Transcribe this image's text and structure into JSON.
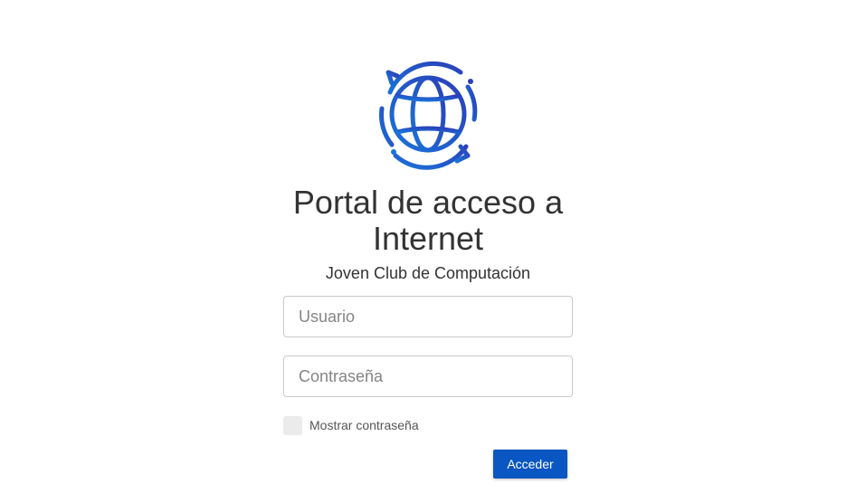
{
  "logo": {
    "icon": "globe-refresh-icon",
    "color_start": "#1a73d9",
    "color_end": "#2b3fb8"
  },
  "header": {
    "title_line1": "Portal de acceso a",
    "title_line2": "Internet",
    "subtitle": "Joven Club de Computación"
  },
  "form": {
    "username": {
      "placeholder": "Usuario",
      "value": ""
    },
    "password": {
      "placeholder": "Contraseña",
      "value": ""
    },
    "show_password_label": "Mostrar contraseña",
    "show_password_checked": false,
    "submit_label": "Acceder",
    "submit_color": "#0a56c2"
  }
}
